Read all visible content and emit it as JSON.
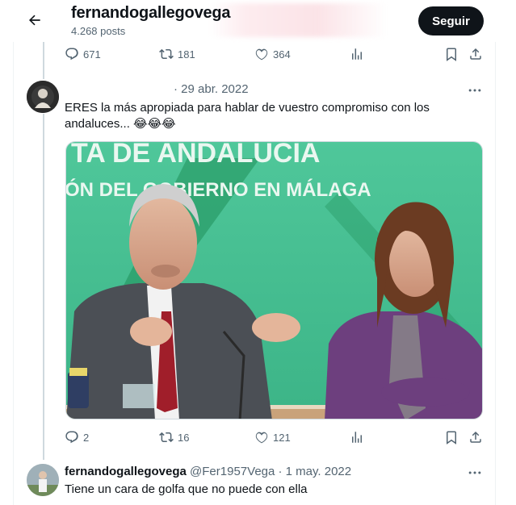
{
  "header": {
    "name": "fernandogallegovega",
    "posts": "4.268 posts",
    "follow_label": "Seguir"
  },
  "tweet_top": {
    "stats": {
      "replies": "671",
      "retweets": "181",
      "likes": "364"
    }
  },
  "tweet_reply": {
    "date": "· 29 abr. 2022",
    "text": "ERES la más apropiada para hablar de vuestro compromiso con los andaluces... 😂😂😂",
    "image_sign_line1": "TA DE ANDALUCIA",
    "image_sign_line2": "ÓN DEL GOBIERNO EN MÁLAGA",
    "stats": {
      "replies": "2",
      "retweets": "16",
      "likes": "121"
    }
  },
  "tweet_next": {
    "name": "fernandogallegovega",
    "handle_date": "@Fer1957Vega · 1 may. 2022",
    "text": "Tiene un cara de golfa que no puede con ella"
  },
  "colors": {
    "text": "#0f1419",
    "muted": "#536471",
    "follow_bg": "#0f1419",
    "border": "#cfd9de",
    "sign_green": "#3bbf8a"
  }
}
